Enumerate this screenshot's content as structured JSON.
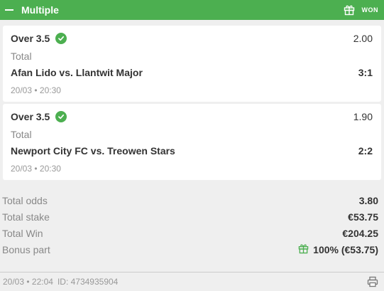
{
  "header": {
    "title": "Multiple",
    "status": "WON",
    "icon": "gift-icon"
  },
  "selections": [
    {
      "name": "Over 3.5",
      "odds": "2.00",
      "market": "Total",
      "event": "Afan Lido vs. Llantwit Major",
      "score": "3:1",
      "datetime": "20/03 • 20:30"
    },
    {
      "name": "Over 3.5",
      "odds": "1.90",
      "market": "Total",
      "event": "Newport City FC vs. Treowen Stars",
      "score": "2:2",
      "datetime": "20/03 • 20:30"
    }
  ],
  "summary": {
    "total_odds_label": "Total odds",
    "total_odds": "3.80",
    "total_stake_label": "Total stake",
    "total_stake": "€53.75",
    "total_win_label": "Total Win",
    "total_win": "€204.25",
    "bonus_label": "Bonus part",
    "bonus_value": "100% (€53.75)"
  },
  "footer": {
    "datetime": "20/03 • 22:04",
    "id": "ID: 4734935904"
  },
  "colors": {
    "accent": "#4caf50",
    "background": "#efefef"
  }
}
